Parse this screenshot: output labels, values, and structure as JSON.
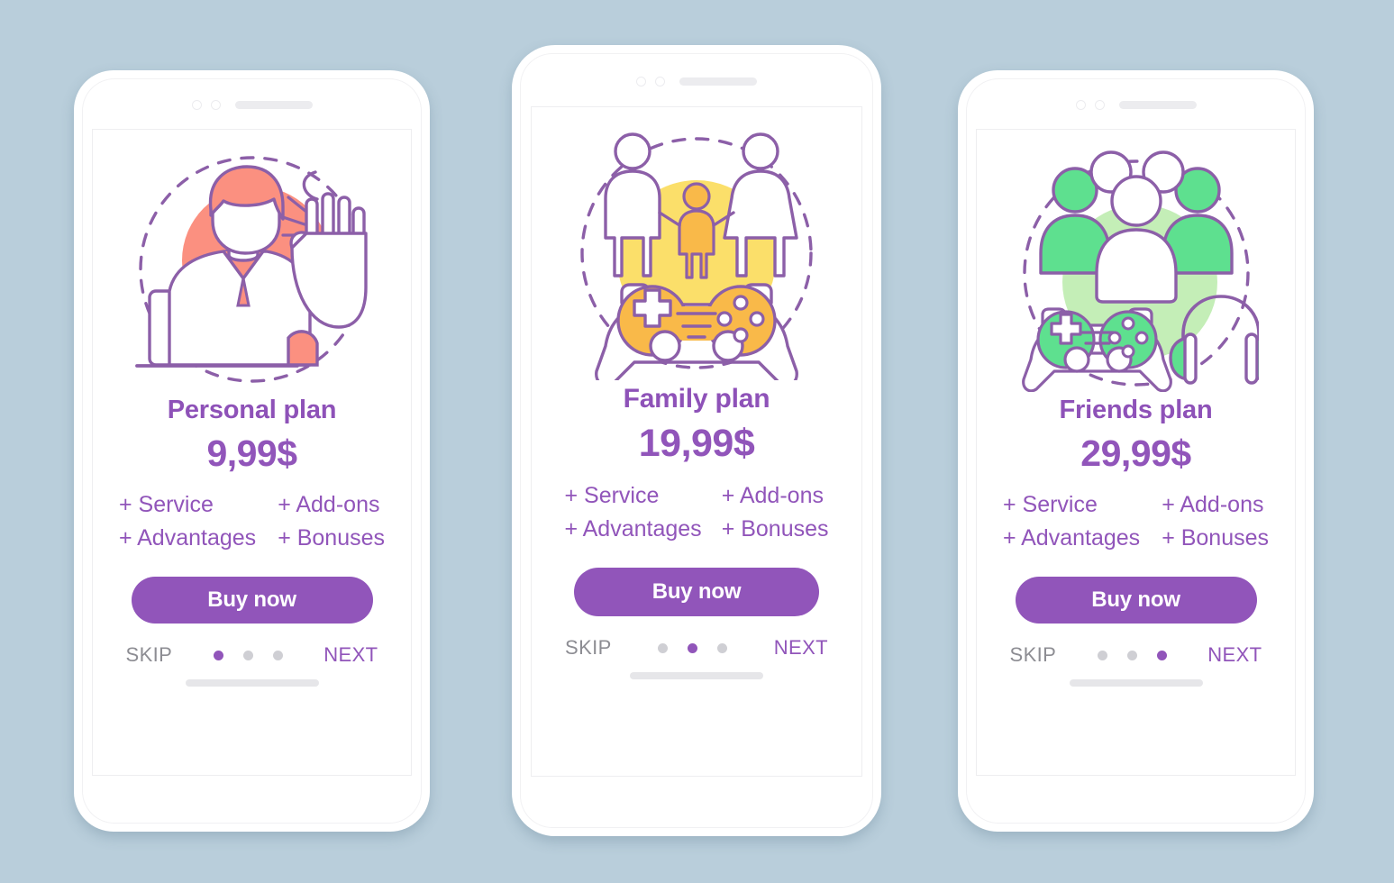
{
  "background_color": "#b9cedb",
  "theme": {
    "purple": "#9155ba",
    "title_purple": "#8e52b8",
    "skip_gray": "#8d8d93",
    "dot_inactive": "#cfcfd4",
    "coral": "#fb9080",
    "yellow": "#fbdf6a",
    "orange": "#f9b949",
    "green": "#5ee08f",
    "light_green": "#c4eeb7",
    "outline_purple": "#8c5fa8"
  },
  "screens": [
    {
      "id": "personal",
      "illustration_name": "person-at-laptop-stop-hand-illustration",
      "accent_color": "#fb9080",
      "title": "Personal plan",
      "price": "9,99$",
      "features": [
        "+ Service",
        "+ Add-ons",
        "+ Advantages",
        "+ Bonuses"
      ],
      "buy_label": "Buy now",
      "skip_label": "SKIP",
      "next_label": "NEXT",
      "dots": {
        "count": 3,
        "active_index": 0
      }
    },
    {
      "id": "family",
      "illustration_name": "family-with-gamepad-illustration",
      "accent_color": "#fbdf6a",
      "title": "Family plan",
      "price": "19,99$",
      "features": [
        "+ Service",
        "+ Add-ons",
        "+ Advantages",
        "+ Bonuses"
      ],
      "buy_label": "Buy now",
      "skip_label": "SKIP",
      "next_label": "NEXT",
      "dots": {
        "count": 3,
        "active_index": 1
      }
    },
    {
      "id": "friends",
      "illustration_name": "friends-group-gamepad-headphones-illustration",
      "accent_color": "#c4eeb7",
      "title": "Friends plan",
      "price": "29,99$",
      "features": [
        "+ Service",
        "+ Add-ons",
        "+ Advantages",
        "+ Bonuses"
      ],
      "buy_label": "Buy now",
      "skip_label": "SKIP",
      "next_label": "NEXT",
      "dots": {
        "count": 3,
        "active_index": 2
      }
    }
  ]
}
